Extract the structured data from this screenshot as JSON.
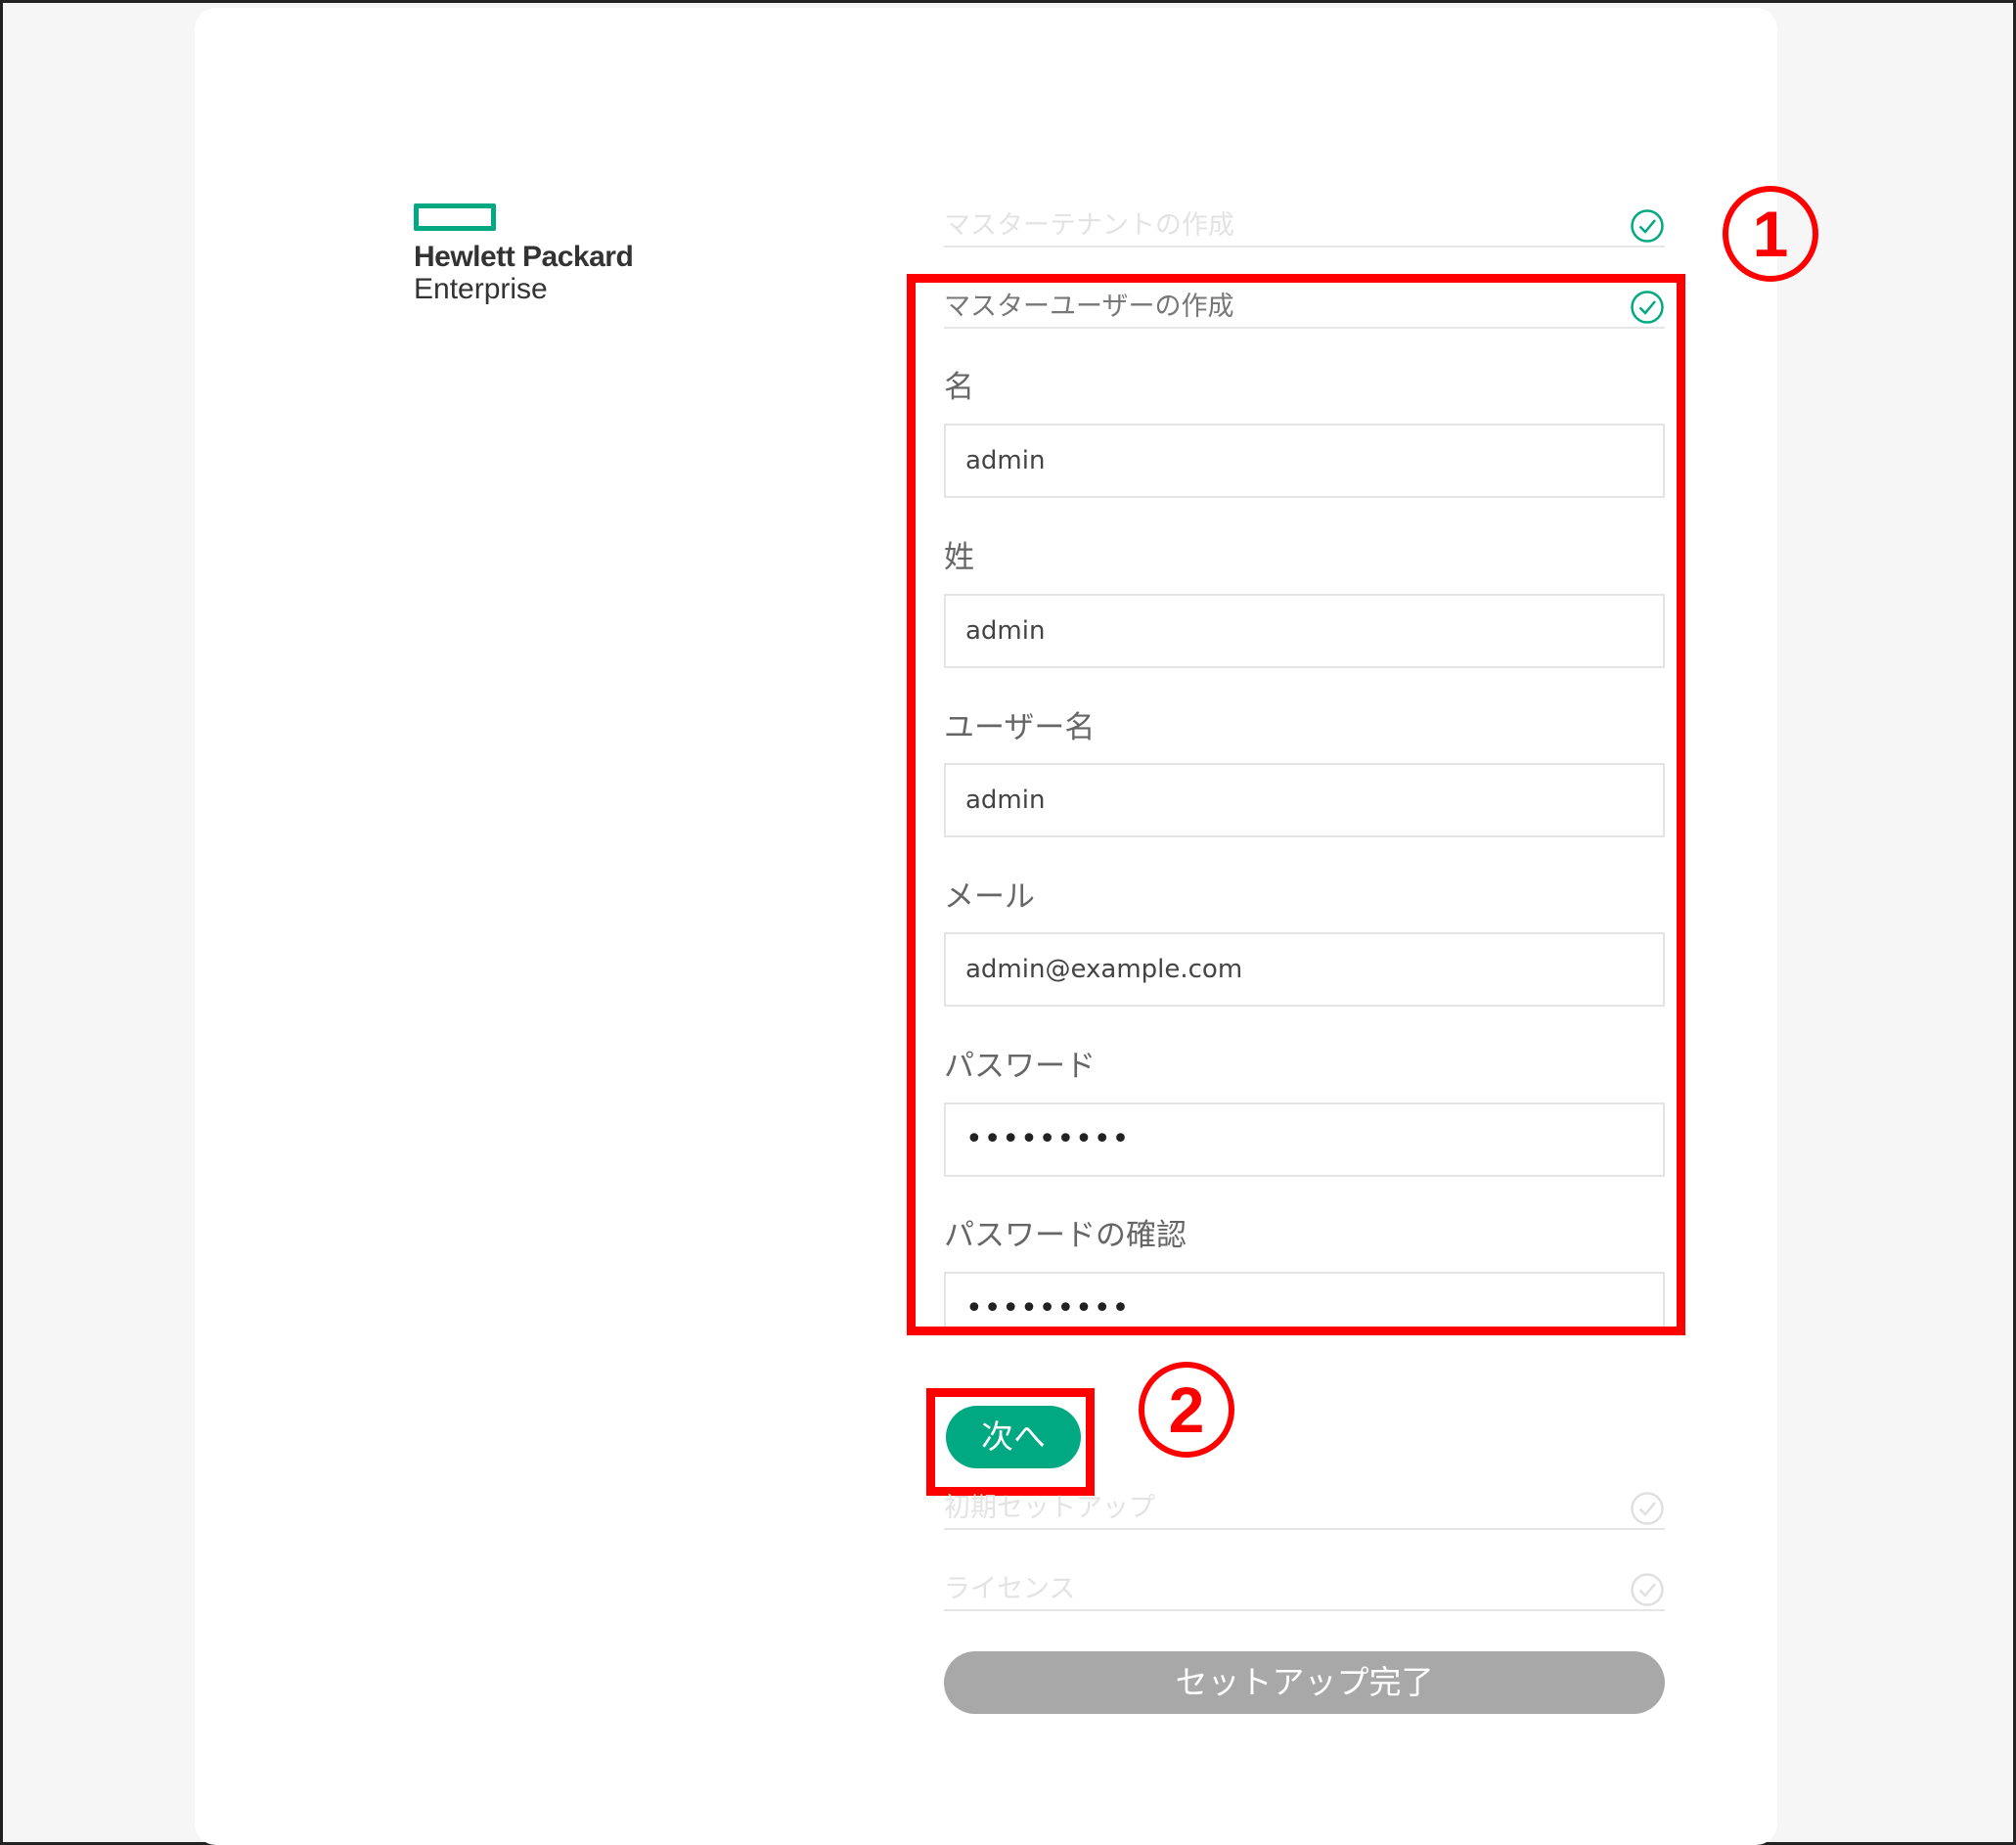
{
  "logo": {
    "line1": "Hewlett Packard",
    "line2": "Enterprise"
  },
  "steps": {
    "tenant": "マスターテナントの作成",
    "user": "マスターユーザーの作成",
    "initial_setup": "初期セットアップ",
    "license": "ライセンス"
  },
  "form": {
    "first_name": {
      "label": "名",
      "value": "admin"
    },
    "last_name": {
      "label": "姓",
      "value": "admin"
    },
    "username": {
      "label": "ユーザー名",
      "value": "admin"
    },
    "email": {
      "label": "メール",
      "value": "admin@example.com"
    },
    "password": {
      "label": "パスワード",
      "value": "•••••••••"
    },
    "password_confirm": {
      "label": "パスワードの確認",
      "value": "•••••••••"
    }
  },
  "buttons": {
    "next": "次へ",
    "finish": "セットアップ完了"
  },
  "annotations": {
    "one": "1",
    "two": "2"
  },
  "colors": {
    "brand": "#01a982",
    "highlight": "#ff0000",
    "disabled": "#a8a8a8"
  }
}
